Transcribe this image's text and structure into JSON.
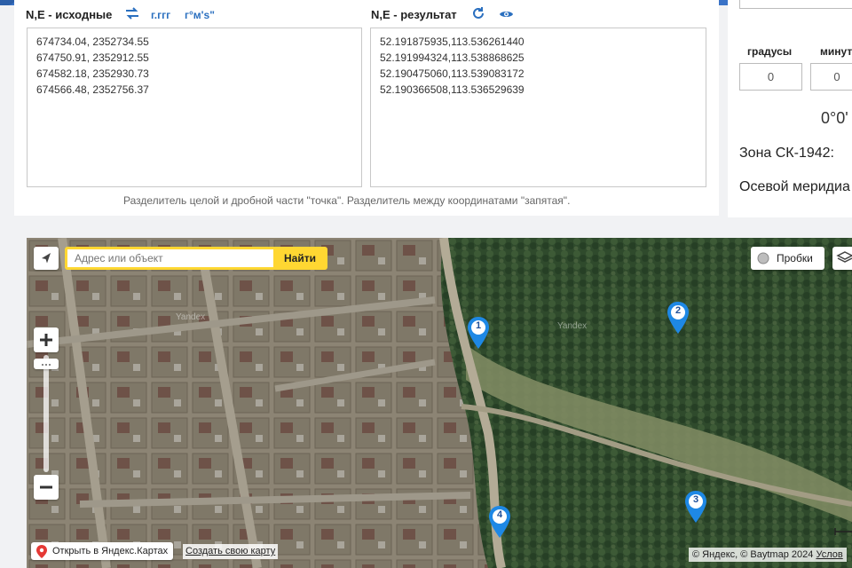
{
  "input_panel": {
    "title": "N,E - исходные",
    "format_decimal": "г.ггг",
    "format_dms": "г°м's\"",
    "lines": [
      "674734.04, 2352734.55",
      "674750.91, 2352912.55",
      "674582.18, 2352930.73",
      "674566.48, 2352756.37"
    ]
  },
  "result_panel": {
    "title": "N,E - результат",
    "lines": [
      "52.191875935,113.536261440",
      "52.191994324,113.538868625",
      "52.190475060,113.539083172",
      "52.190366508,113.536529639"
    ]
  },
  "hint": "Разделитель целой и дробной части \"точка\". Разделитель между координатами \"запятая\".",
  "side_panel": {
    "degrees_label": "градусы",
    "minutes_label": "минут",
    "degrees_value": "0",
    "minutes_value": "0",
    "dms_display": "0°0'",
    "zone_label": "Зона СК-1942:",
    "meridian_label": "Осевой меридиа"
  },
  "map": {
    "search_placeholder": "Адрес или объект",
    "search_button": "Найти",
    "traffic_label": "Пробки",
    "open_in_yandex": "Открыть в Яндекс.Картах",
    "create_map": "Создать свою карту",
    "copyright": "© Яндекс, © Baytmap 2024",
    "terms": "Услов",
    "watermark": "Yandex",
    "markers": [
      "1",
      "2",
      "3",
      "4"
    ]
  },
  "colors": {
    "accent": "#2a6fbf",
    "search_bar": "#ffd732",
    "marker": "#1e88e5"
  }
}
